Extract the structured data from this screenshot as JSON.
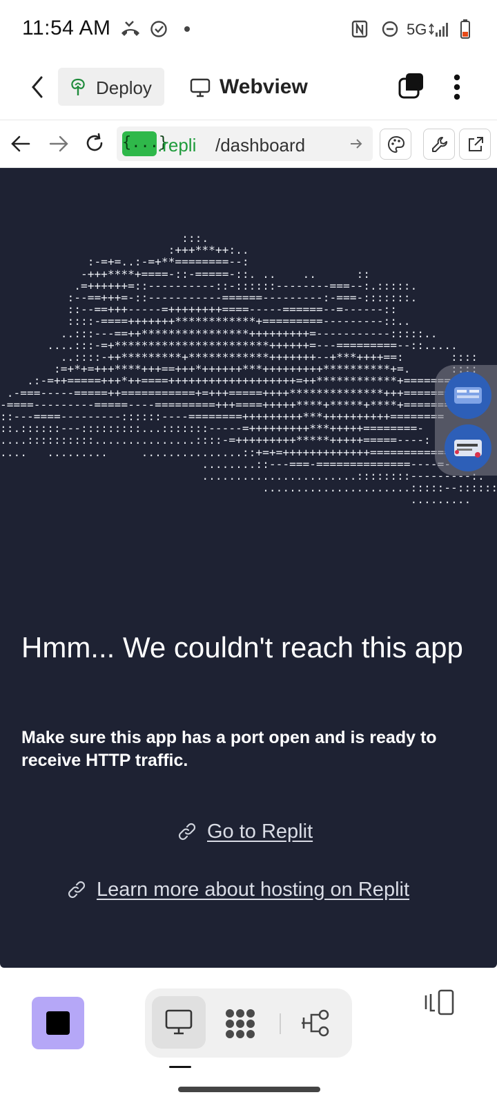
{
  "status_bar": {
    "time": "11:54 AM",
    "network": "5G",
    "icons": [
      "missed-call-icon",
      "check-circle-icon",
      "dot-icon",
      "nfc-icon",
      "do-not-disturb-icon",
      "signal-icon",
      "battery-low-icon"
    ],
    "battery_color": "#e64a19"
  },
  "top_bar": {
    "back_icon": "chevron-left-icon",
    "deploy_label": "Deploy",
    "deploy_icon": "deploy-tree-icon",
    "title_icon": "monitor-icon",
    "title": "Webview",
    "tabs_icon": "tabs-icon",
    "menu_icon": "more-vertical-icon"
  },
  "url_bar": {
    "badge": "{...}",
    "domain": ".repli",
    "path": "/dashboard",
    "accent_color": "#2fb84a",
    "tools": [
      "palette-icon",
      "wrench-icon",
      "external-link-icon"
    ]
  },
  "webview": {
    "background": "#1e2233",
    "ascii_art": "                           :::.\n                         :+++***++:..\n             :-=+=..:-=+**========--:\n            -+++****+====-::-=====-::. ..    ..      ::\n           .=++++++=::----------::-::::::--------===--:.:::::.\n          :--==+++=-::-----------======---------:-===-:::::::.\n          ::--==+++-----=++++++++====-----======--=------::\n          ::::-====+++++++************+=========---------::..\n         ..:::---==++****************+++++++++=-----------:::::..\n       ....:::-=+***********************++++++=---=========--::.....\n         ..::::-++*********+************+++++++--+***++++==:       ::::\n        :=+*+=+++****+++==+++*++++++***+++++++++**********+=.      ::::\n    .:-=++=====+++*++====+++++++++++++++++++=++************+=========\n .-===-----=====++===========+=+++=====++++**************+++=======\n-====---------=====----=========+++====+++++****+*****+****+=======\n::---====---------::::::----========+++++++++***++++++++++========\n::.::::::---:::::::::...:::::::-----=+++++++++***+++++========-\n....::::::::::...............::::-=+++++++++*****+++++=====----:\n....   .........     ...............::+=+=+++++++++++++=============\n                              ........::---===-==============----=---:\n                              .......................::::::::---------:.\n                                       ......................:::::--::::::.\n                                                             .........",
    "error_title": "Hmm... We couldn't reach this app",
    "error_body": "Make sure this app has a port open and is ready to receive HTTP traffic.",
    "link_primary": "Go to Replit",
    "link_secondary": "Learn more about hosting on Replit",
    "link_icon": "link-icon"
  },
  "bottom_nav": {
    "stop_color": "#b5a7f7",
    "stop_icon": "stop-icon",
    "views": [
      "monitor-icon",
      "extensions-grid-icon",
      "git-branch-icon"
    ],
    "panel_icon": "panel-toggle-icon"
  }
}
